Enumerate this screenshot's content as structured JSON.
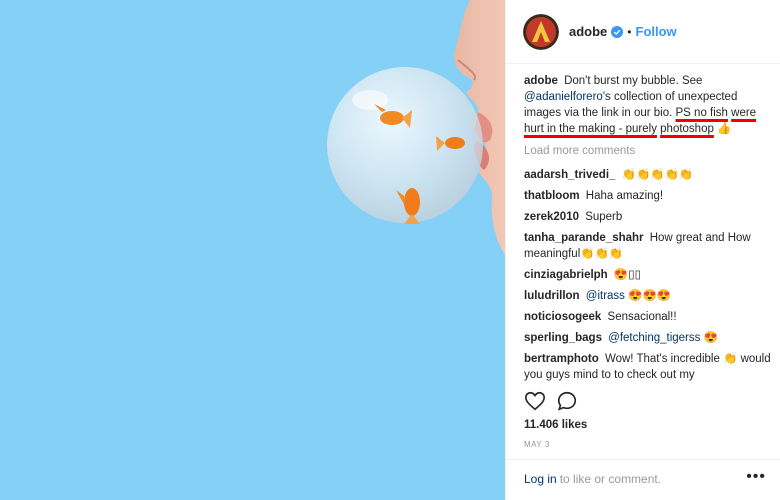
{
  "post": {
    "username": "adobe",
    "follow_label": "Follow",
    "separator": "•"
  },
  "caption": {
    "username": "adobe",
    "text_1": "Don't burst my bubble. See",
    "mention": "@adanielforero",
    "text_2": "'s collection of unexpected images via the link in our bio.",
    "highlight_1": "PS no fish",
    "highlight_2": "were hurt in the making - purely",
    "highlight_3": "photoshop",
    "emoji": "👍"
  },
  "load_more_label": "Load more comments",
  "comments": [
    {
      "username": "aadarsh_trivedi_",
      "text": "👏👏👏👏👏"
    },
    {
      "username": "thatbloom",
      "text": "Haha amazing!"
    },
    {
      "username": "zerek2010",
      "text": "Superb"
    },
    {
      "username": "tanha_parande_shahr",
      "text": "How great and How meaningful👏👏👏"
    },
    {
      "username": "cinziagabrielph",
      "text": "😍▯▯"
    },
    {
      "username": "luludrillon",
      "mention": "@itrass",
      "text": "😍😍😍"
    },
    {
      "username": "noticiosogeek",
      "text": "Sensacional!!"
    },
    {
      "username": "sperling_bags",
      "mention": "@fetching_tigerss",
      "text": "😍"
    },
    {
      "username": "bertramphoto",
      "text": "Wow! That's incredible 👏 would you guys mind to to check out my"
    }
  ],
  "icons": {
    "like": "heart-icon",
    "comment": "comment-icon",
    "verified": "verified-badge-icon",
    "more": "more-options-icon"
  },
  "likes_label": "11.406 likes",
  "date_label": "MAY 3",
  "login": {
    "link_label": "Log in",
    "text": "to like or comment."
  },
  "more_label": "•••",
  "colors": {
    "background_photo": "#85d0f6",
    "link_blue": "#3897f0",
    "mention_blue": "#003569",
    "annotation_red": "#e00000"
  }
}
